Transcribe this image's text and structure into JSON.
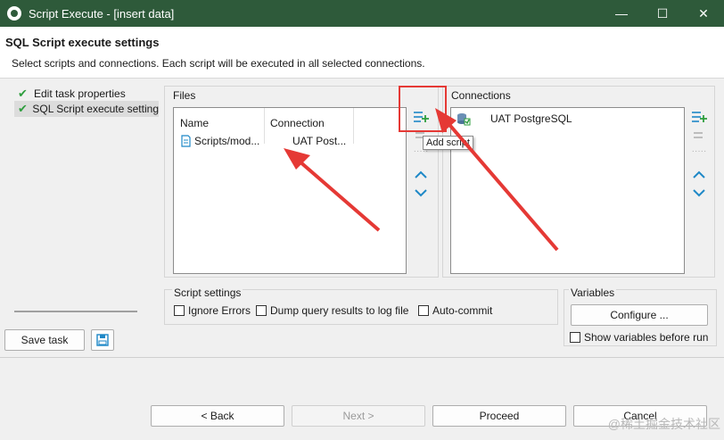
{
  "window": {
    "title": "Script Execute - [insert data]",
    "minimize": "—",
    "maximize": "☐",
    "close": "✕"
  },
  "header": {
    "title": "SQL Script execute settings",
    "description": "Select scripts and connections. Each script will be executed in all selected connections."
  },
  "nav": {
    "items": [
      {
        "label": "Edit task properties",
        "selected": false
      },
      {
        "label": "SQL Script execute setting",
        "selected": true
      }
    ]
  },
  "left_buttons": {
    "save_task": "Save task"
  },
  "files": {
    "label": "Files",
    "columns": [
      "Name",
      "Connection"
    ],
    "rows": [
      {
        "name": "Scripts/mod...",
        "connection": "UAT Post..."
      }
    ]
  },
  "connections": {
    "label": "Connections",
    "items": [
      {
        "name": "UAT PostgreSQL"
      }
    ]
  },
  "tooltip": "Add script",
  "script_settings": {
    "label": "Script settings",
    "ignore_errors": "Ignore Errors",
    "dump_results": "Dump query results to log file",
    "auto_commit": "Auto-commit"
  },
  "variables": {
    "label": "Variables",
    "configure": "Configure ...",
    "show_before_run": "Show variables before run"
  },
  "footer": {
    "back": "< Back",
    "next": "Next >",
    "proceed": "Proceed",
    "cancel": "Cancel"
  },
  "watermark": "@稀土掘金技术社区",
  "icons": [
    "app-logo-icon",
    "check-icon",
    "script-file-icon",
    "add-script-icon",
    "remove-icon",
    "move-up-icon",
    "move-down-icon",
    "database-icon",
    "save-icon",
    "window-controls"
  ],
  "colors": {
    "titlebar": "#2e5a3a",
    "accent": "#1e88c7",
    "check": "#2e9e3e",
    "annotation": "#e53935"
  }
}
